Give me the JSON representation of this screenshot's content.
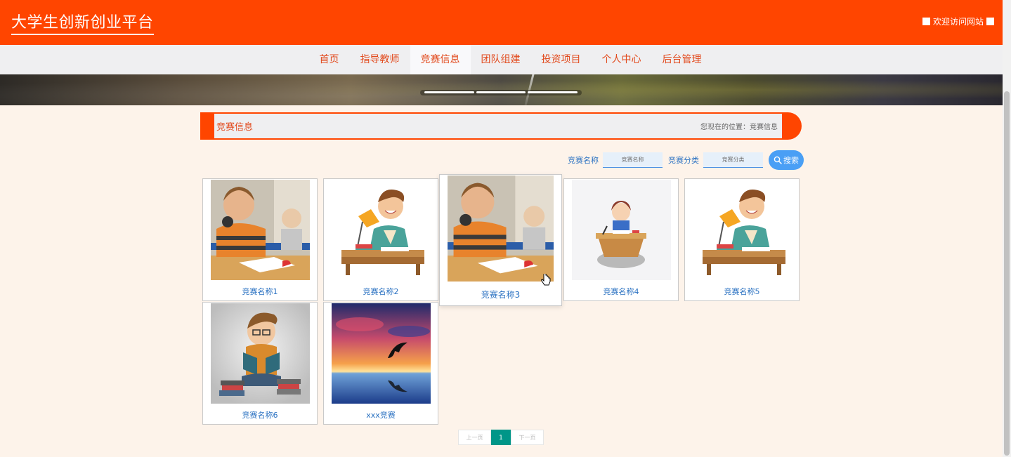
{
  "header": {
    "site_title": "大学生创新创业平台",
    "welcome": "欢迎访问网站",
    "bg_color": "#ff4500"
  },
  "nav": {
    "items": [
      {
        "label": "首页",
        "active": false
      },
      {
        "label": "指导教师",
        "active": false
      },
      {
        "label": "竞赛信息",
        "active": true
      },
      {
        "label": "团队组建",
        "active": false
      },
      {
        "label": "投资项目",
        "active": false
      },
      {
        "label": "个人中心",
        "active": false
      },
      {
        "label": "后台管理",
        "active": false
      }
    ]
  },
  "breadcrumb": {
    "title": "竞赛信息",
    "position": "您现在的位置：竞赛信息"
  },
  "search": {
    "name_label": "竞赛名称",
    "name_placeholder": "竞赛名称",
    "category_label": "竞赛分类",
    "category_placeholder": "竞赛分类",
    "button_label": "搜索",
    "button_icon": "search-icon"
  },
  "cards": [
    {
      "label": "竞赛名称1",
      "image": "boy-thinking-photo"
    },
    {
      "label": "竞赛名称2",
      "image": "cartoon-boy-desk-lamp"
    },
    {
      "label": "竞赛名称3",
      "image": "boy-thinking-photo"
    },
    {
      "label": "竞赛名称4",
      "image": "cartoon-girl-desk"
    },
    {
      "label": "竞赛名称5",
      "image": "cartoon-boy-desk-lamp"
    },
    {
      "label": "竞赛名称6",
      "image": "cartoon-boy-reading-books"
    },
    {
      "label": "xxx竞赛",
      "image": "sunset-dolphin"
    }
  ],
  "pagination": {
    "prev": "上一页",
    "current": "1",
    "next": "下一页",
    "active_color": "#009688"
  }
}
